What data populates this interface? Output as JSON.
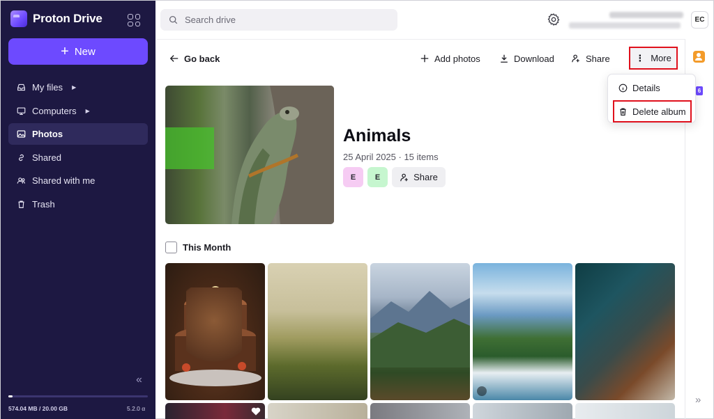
{
  "sidebar": {
    "brand": "Proton Drive",
    "new_label": "New",
    "items": [
      {
        "label": "My files",
        "icon": "inbox-icon",
        "has_caret": true
      },
      {
        "label": "Computers",
        "icon": "monitor-icon",
        "has_caret": true
      },
      {
        "label": "Photos",
        "icon": "image-icon",
        "active": true
      },
      {
        "label": "Shared",
        "icon": "link-icon"
      },
      {
        "label": "Shared with me",
        "icon": "users-icon"
      },
      {
        "label": "Trash",
        "icon": "trash-icon"
      }
    ],
    "storage_text": "574.04 MB / 20.00 GB",
    "storage_fraction": 0.028,
    "version": "5.2.0 α"
  },
  "topbar": {
    "search_placeholder": "Search drive",
    "avatar_initials": "EC"
  },
  "toolbar": {
    "go_back": "Go back",
    "add_photos": "Add photos",
    "download": "Download",
    "share": "Share",
    "more": "More"
  },
  "more_menu": {
    "details": "Details",
    "delete_album": "Delete album"
  },
  "album": {
    "title": "Animals",
    "meta": "25 April 2025 · 15 items",
    "members": [
      "E",
      "E"
    ],
    "share_label": "Share"
  },
  "section": {
    "label": "This Month"
  },
  "colors": {
    "sidebar_bg": "#1d1842",
    "accent": "#6d4aff",
    "highlight_box": "#e0101c"
  }
}
